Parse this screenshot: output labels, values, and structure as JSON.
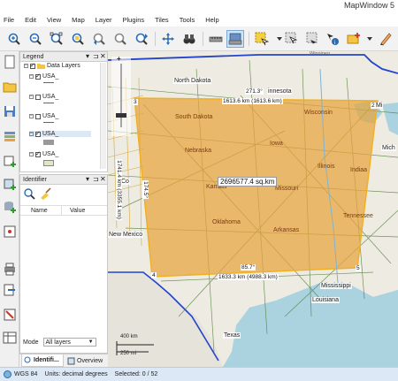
{
  "app": {
    "title": "MapWindow 5"
  },
  "menu": [
    "File",
    "Edit",
    "View",
    "Map",
    "Layer",
    "Plugins",
    "Tiles",
    "Tools",
    "Help"
  ],
  "toolbar": {
    "icons": [
      "zoom-in-icon",
      "zoom-out-icon",
      "zoom-extent-icon",
      "zoom-selection-icon",
      "zoom-previous-icon",
      "zoom-next-icon",
      "pan-icon",
      "binoculars-icon",
      "measure-distance-icon",
      "measure-area-icon",
      "select-icon",
      "deselect-icon",
      "identify-icon",
      "add-layer-icon",
      "pencil-icon"
    ]
  },
  "legend": {
    "title": "Legend",
    "group": "Data Layers",
    "layers": [
      {
        "name": "USA_",
        "checked": true
      },
      {
        "name": "USA_",
        "checked": false
      },
      {
        "name": "USA_",
        "checked": false
      },
      {
        "name": "USA_",
        "checked": true
      },
      {
        "name": "USA_",
        "checked": true
      }
    ]
  },
  "identifier": {
    "title": "Identifier",
    "columns": [
      "Name",
      "Value"
    ],
    "mode_label": "Mode",
    "mode_value": "All layers"
  },
  "tabs": {
    "identifier": "Identifi...",
    "overview": "Overview"
  },
  "map": {
    "places": {
      "winnipeg": "Winnipeg",
      "north_dakota": "North Dakota",
      "minnesota": "innesota",
      "mi": "Mi",
      "mich": "Mich",
      "co": "Co",
      "new_mexico": "New Mexico",
      "texas": "Texas",
      "mississippi": "Mississippi",
      "louisiana": "Louisiana"
    },
    "states": {
      "south_dakota": "South Dakota",
      "wisconsin": "Wisconsin",
      "iowa": "Iowa",
      "nebraska": "Nebraska",
      "illinois": "Illinois",
      "indiana": "Indiaa",
      "kansas": "Kansas",
      "missouri": "Missouri",
      "oklahoma": "Oklahoma",
      "tennessee": "Tennessee",
      "arkansas": "Arkansas"
    },
    "measure": {
      "area": "2696577.4 sq.km",
      "top": "1613.6 km (1613.6 km)",
      "top_angle": "271.3°",
      "left": "1741.4 km (3355.1 km)",
      "left_angle": "174.5°",
      "bottom": "1633.3 km (4988.3 km)",
      "bottom_angle": "85.7°",
      "vertices": [
        "2",
        "3",
        "4",
        "5"
      ]
    },
    "scale": {
      "top": "400 km",
      "bottom": "250 mi"
    }
  },
  "status": {
    "crs": "WGS 84",
    "units": "Units: decimal degrees",
    "selected": "Selected: 0 / 52"
  },
  "colors": {
    "measure_fill": "#e8a33c",
    "measure_stroke": "#e0a020",
    "status_bg": "#dce8f5"
  }
}
